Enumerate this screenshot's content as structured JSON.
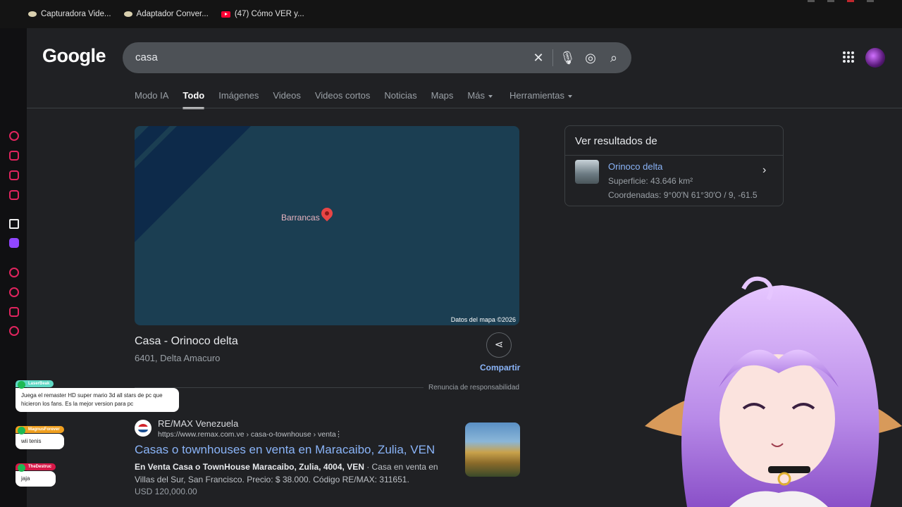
{
  "bookmarks": [
    {
      "label": "Capturadora Vide...",
      "icon": "bookmark-icon"
    },
    {
      "label": "Adaptador Conver...",
      "icon": "bookmark-icon"
    },
    {
      "label": "(47) Cómo VER y...",
      "icon": "youtube-icon"
    }
  ],
  "google": {
    "logo": "Google",
    "search": {
      "value": "casa"
    },
    "tabs": [
      "Modo IA",
      "Todo",
      "Imágenes",
      "Videos",
      "Videos cortos",
      "Noticias",
      "Maps",
      "Más",
      "Herramientas"
    ],
    "active_tab": "Todo"
  },
  "map": {
    "pin_label": "Barrancas",
    "credit": "Datos del mapa ©2026"
  },
  "place": {
    "title": "Casa - Orinoco delta",
    "subtitle": "6401, Delta Amacuro",
    "share_label": "Compartir",
    "disclaimer": "Renuncia de responsabilidad"
  },
  "result": {
    "site_name": "RE/MAX Venezuela",
    "url": "https://www.remax.com.ve › casa-o-townhouse › venta",
    "title": "Casas o townhouses en venta en Maracaibo, Zulia, VEN",
    "snippet_bold": "En Venta Casa o TownHouse Maracaibo, Zulia, 4004, VEN",
    "snippet_rest": " · Casa en venta en Villas del Sur, San Francisco. Precio: $ 38.000. Código RE/MAX: 311651.",
    "price": "USD 120,000.00"
  },
  "side_panel": {
    "title": "Ver resultados de",
    "link": "Orinoco delta",
    "line1": "Superficie: 43.646 km²",
    "line2": "Coordenadas: 9°00′N 61°30′O / 9, -61.5"
  },
  "chat": [
    {
      "user": "LaserBeak",
      "message": "Juega el remaster HD super mario 3d all stars de pc que hicieron los fans. Es la mejor version para pc",
      "color": "#5ed8c4"
    },
    {
      "user": "MagnusForever",
      "message": "wii tenis",
      "color": "#f0a020"
    },
    {
      "user": "TheDestruc",
      "message": "jaja",
      "color": "#d81848"
    }
  ]
}
